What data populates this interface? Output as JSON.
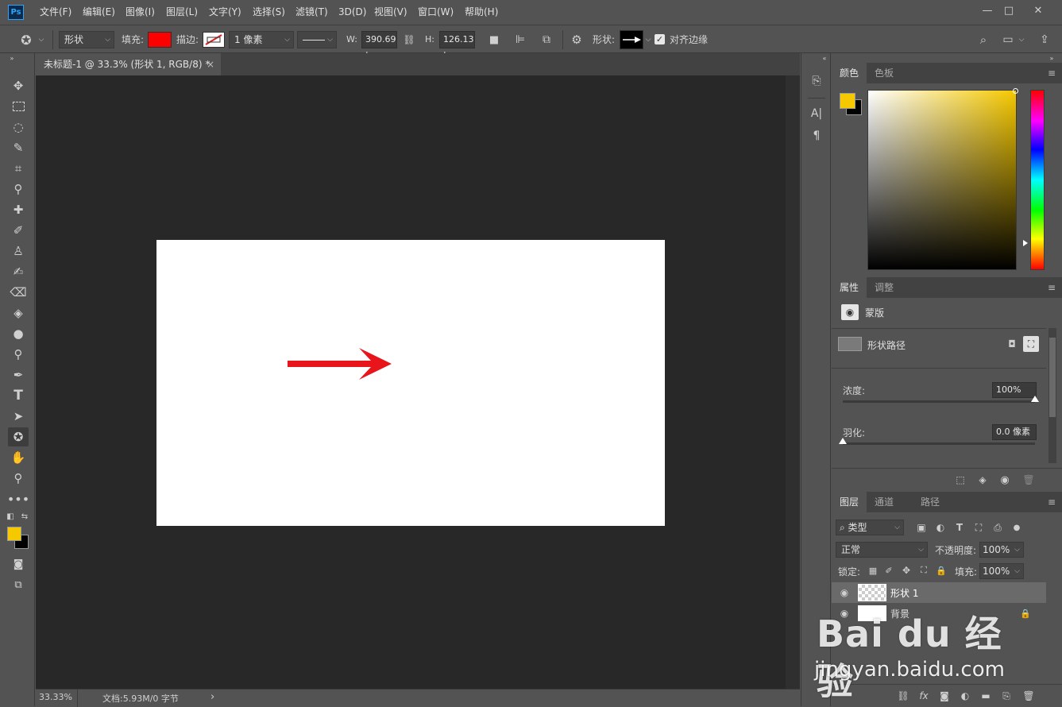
{
  "app": {
    "logo": "Ps"
  },
  "menu": [
    "文件(F)",
    "编辑(E)",
    "图像(I)",
    "图层(L)",
    "文字(Y)",
    "选择(S)",
    "滤镜(T)",
    "3D(D)",
    "视图(V)",
    "窗口(W)",
    "帮助(H)"
  ],
  "window_controls": {
    "minimize": "—",
    "restore": "□",
    "close": "✕"
  },
  "options": {
    "mode_value": "形状",
    "fill_label": "填充:",
    "fill_color": "#ff0000",
    "stroke_label": "描边:",
    "stroke_width_value": "1 像素",
    "w_label": "W:",
    "w_value": "390.69 |",
    "h_label": "H:",
    "h_value": "126.13 |",
    "shape_label": "形状:",
    "align_edges_label": "对齐边缘"
  },
  "document": {
    "tab_title": "未标题-1 @ 33.3% (形状 1, RGB/8) *",
    "tab_close": "×",
    "arrow_color": "#e8151b"
  },
  "status": {
    "zoom": "33.33%",
    "doc_info": "文档:5.93M/0 字节",
    "arrow": "›"
  },
  "colors": {
    "foreground": "#f5c800",
    "background": "#000000"
  },
  "color_panel": {
    "tabs": [
      "颜色",
      "色板"
    ]
  },
  "properties_panel": {
    "tabs": [
      "属性",
      "调整"
    ],
    "mask_label": "蒙版",
    "shape_path_label": "形状路径",
    "density_label": "浓度:",
    "density_value": "100%",
    "density_level": 1.0,
    "feather_label": "羽化:",
    "feather_value": "0.0 像素",
    "feather_level": 0.0
  },
  "layers_panel": {
    "tabs": [
      "图层",
      "通道",
      "路径"
    ],
    "filter_value": "类型",
    "blend_mode": "正常",
    "opacity_label": "不透明度:",
    "opacity_value": "100%",
    "lock_label": "锁定:",
    "fill_label": "填充:",
    "fill_value": "100%",
    "layers": [
      {
        "name": "形状 1",
        "selected": true,
        "locked": false
      },
      {
        "name": "背景",
        "selected": false,
        "locked": true
      }
    ]
  },
  "watermark": {
    "brand": "Bai du 经验",
    "url": "jingyan.baidu.com"
  }
}
